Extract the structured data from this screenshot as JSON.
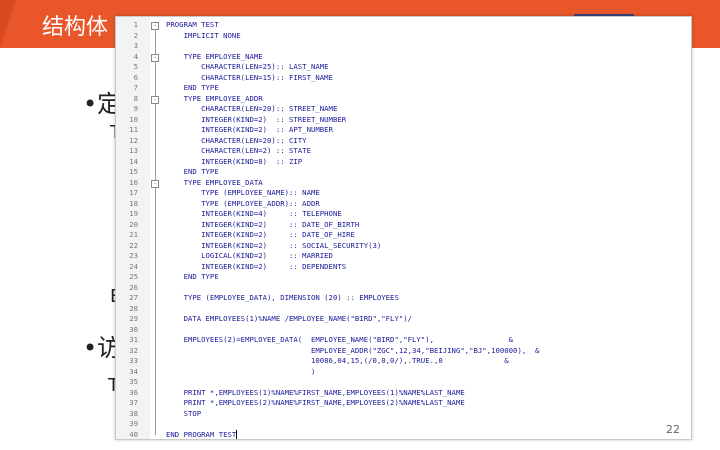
{
  "slide": {
    "title": "结构体",
    "page_number": "22",
    "fragments": {
      "bullet1": "•定",
      "text1": "T",
      "text2": "E",
      "bullet2": "•访",
      "text3": "T"
    }
  },
  "editor": {
    "lines": [
      {
        "n": "1",
        "text": "PROGRAM TEST",
        "fold": "-"
      },
      {
        "n": "2",
        "text": "    IMPLICIT NONE",
        "fold": ""
      },
      {
        "n": "3",
        "text": "",
        "fold": ""
      },
      {
        "n": "4",
        "text": "    TYPE EMPLOYEE_NAME",
        "fold": "-"
      },
      {
        "n": "5",
        "text": "        CHARACTER(LEN=25):: LAST_NAME",
        "fold": ""
      },
      {
        "n": "6",
        "text": "        CHARACTER(LEN=15):: FIRST_NAME",
        "fold": ""
      },
      {
        "n": "7",
        "text": "    END TYPE",
        "fold": ""
      },
      {
        "n": "8",
        "text": "    TYPE EMPLOYEE_ADDR",
        "fold": "-"
      },
      {
        "n": "9",
        "text": "        CHARACTER(LEN=20):: STREET_NAME",
        "fold": ""
      },
      {
        "n": "10",
        "text": "        INTEGER(KIND=2)  :: STREET_NUMBER",
        "fold": ""
      },
      {
        "n": "11",
        "text": "        INTEGER(KIND=2)  :: APT_NUMBER",
        "fold": ""
      },
      {
        "n": "12",
        "text": "        CHARACTER(LEN=20):: CITY",
        "fold": ""
      },
      {
        "n": "13",
        "text": "        CHARACTER(LEN=2) :: STATE",
        "fold": ""
      },
      {
        "n": "14",
        "text": "        INTEGER(KIND=8)  :: ZIP",
        "fold": ""
      },
      {
        "n": "15",
        "text": "    END TYPE",
        "fold": ""
      },
      {
        "n": "16",
        "text": "    TYPE EMPLOYEE_DATA",
        "fold": "-"
      },
      {
        "n": "17",
        "text": "        TYPE (EMPLOYEE_NAME):: NAME",
        "fold": ""
      },
      {
        "n": "18",
        "text": "        TYPE (EMPLOYEE_ADDR):: ADDR",
        "fold": ""
      },
      {
        "n": "19",
        "text": "        INTEGER(KIND=4)     :: TELEPHONE",
        "fold": ""
      },
      {
        "n": "20",
        "text": "        INTEGER(KIND=2)     :: DATE_OF_BIRTH",
        "fold": ""
      },
      {
        "n": "21",
        "text": "        INTEGER(KIND=2)     :: DATE_OF_HIRE",
        "fold": ""
      },
      {
        "n": "22",
        "text": "        INTEGER(KIND=2)     :: SOCIAL_SECURITY(3)",
        "fold": ""
      },
      {
        "n": "23",
        "text": "        LOGICAL(KIND=2)     :: MARRIED",
        "fold": ""
      },
      {
        "n": "24",
        "text": "        INTEGER(KIND=2)     :: DEPENDENTS",
        "fold": ""
      },
      {
        "n": "25",
        "text": "    END TYPE",
        "fold": ""
      },
      {
        "n": "26",
        "text": "",
        "fold": ""
      },
      {
        "n": "27",
        "text": "    TYPE (EMPLOYEE_DATA), DIMENSION (20) :: EMPLOYEES",
        "fold": ""
      },
      {
        "n": "28",
        "text": "",
        "fold": ""
      },
      {
        "n": "29",
        "text": "    DATA EMPLOYEES(1)%NAME /EMPLOYEE_NAME(\"BIRD\",\"FLY\")/",
        "fold": ""
      },
      {
        "n": "30",
        "text": "",
        "fold": ""
      },
      {
        "n": "31",
        "text": "    EMPLOYEES(2)=EMPLOYEE_DATA(  EMPLOYEE_NAME(\"BIRD\",\"FLY\"),                 &",
        "fold": ""
      },
      {
        "n": "32",
        "text": "                                 EMPLOYEE_ADDR(\"ZGC\",12,34,\"BEIJING\",\"BJ\",100000),  &",
        "fold": ""
      },
      {
        "n": "33",
        "text": "                                 10086,04,15,(/0,0,0/),.TRUE.,0              &",
        "fold": ""
      },
      {
        "n": "34",
        "text": "                                 )",
        "fold": ""
      },
      {
        "n": "35",
        "text": "",
        "fold": ""
      },
      {
        "n": "36",
        "text": "    PRINT *,EMPLOYEES(1)%NAME%FIRST_NAME,EMPLOYEES(1)%NAME%LAST_NAME",
        "fold": ""
      },
      {
        "n": "37",
        "text": "    PRINT *,EMPLOYEES(2)%NAME%FIRST_NAME,EMPLOYEES(2)%NAME%LAST_NAME",
        "fold": ""
      },
      {
        "n": "38",
        "text": "    STOP",
        "fold": ""
      },
      {
        "n": "39",
        "text": "",
        "fold": ""
      },
      {
        "n": "40",
        "text": "END PROGRAM TEST",
        "fold": ""
      }
    ]
  }
}
